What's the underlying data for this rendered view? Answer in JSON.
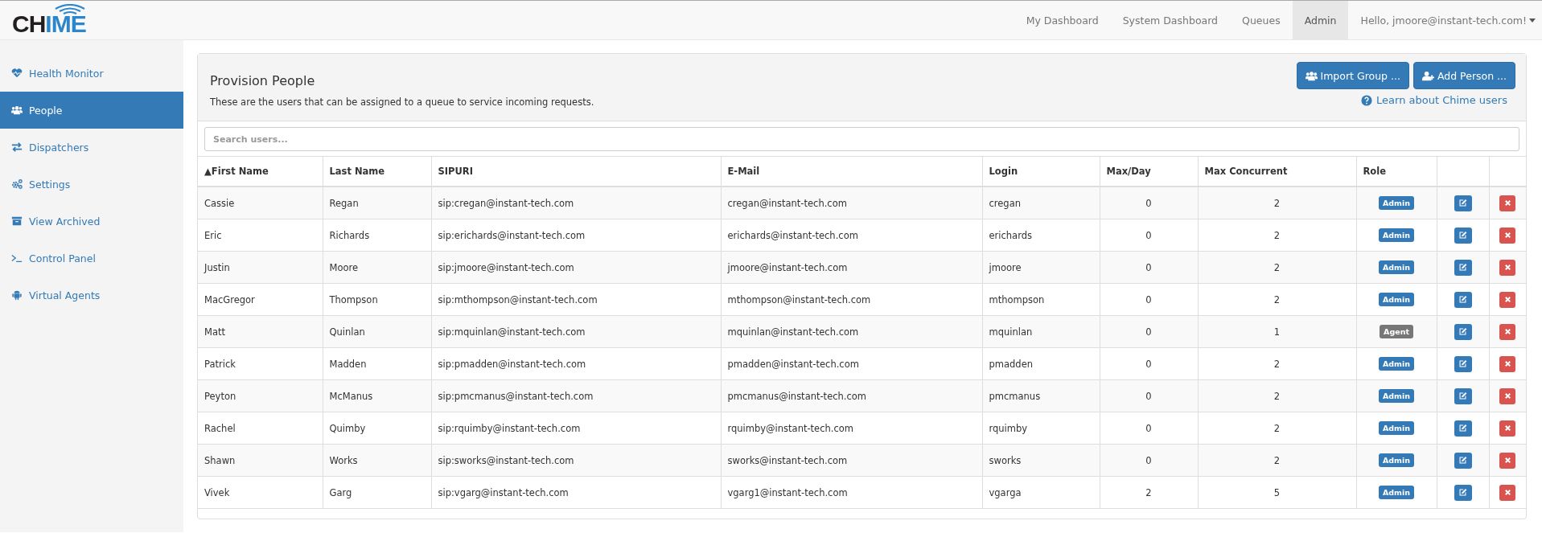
{
  "logo": {
    "dark": "CH",
    "accent": "IME"
  },
  "nav": [
    {
      "label": "My Dashboard",
      "selected": false
    },
    {
      "label": "System Dashboard",
      "selected": false
    },
    {
      "label": "Queues",
      "selected": false
    },
    {
      "label": "Admin",
      "selected": true
    }
  ],
  "user_menu": {
    "label": "Hello, jmoore@instant-tech.com!"
  },
  "sidebar": {
    "items": [
      {
        "label": "Health Monitor",
        "selected": false
      },
      {
        "label": "People",
        "selected": true
      },
      {
        "label": "Dispatchers",
        "selected": false
      },
      {
        "label": "Settings",
        "selected": false
      },
      {
        "label": "View Archived",
        "selected": false
      },
      {
        "label": "Control Panel",
        "selected": false
      },
      {
        "label": "Virtual Agents",
        "selected": false
      }
    ]
  },
  "panel": {
    "title": "Provision People",
    "description": "These are the users that can be assigned to a queue to service incoming requests.",
    "buttons": [
      "Import Group ...",
      "Add Person ..."
    ],
    "help_link": "Learn about Chime users",
    "search": {
      "placeholder": "Search users..."
    }
  },
  "table": {
    "columns": [
      "▲First Name",
      "Last Name",
      "SIPURI",
      "E-Mail",
      "Login",
      "Max/Day",
      "Max Concurrent",
      "Role"
    ],
    "rows": [
      {
        "first": "Cassie",
        "last": "Regan",
        "sipuri": "sip:cregan@instant-tech.com",
        "email": "cregan@instant-tech.com",
        "login": "cregan",
        "max_day": "0",
        "max_concurrent": "2",
        "role": {
          "label": "Admin",
          "kind": "admin"
        }
      },
      {
        "first": "Eric",
        "last": "Richards",
        "sipuri": "sip:erichards@instant-tech.com",
        "email": "erichards@instant-tech.com",
        "login": "erichards",
        "max_day": "0",
        "max_concurrent": "2",
        "role": {
          "label": "Admin",
          "kind": "admin"
        }
      },
      {
        "first": "Justin",
        "last": "Moore",
        "sipuri": "sip:jmoore@instant-tech.com",
        "email": "jmoore@instant-tech.com",
        "login": "jmoore",
        "max_day": "0",
        "max_concurrent": "2",
        "role": {
          "label": "Admin",
          "kind": "admin"
        }
      },
      {
        "first": "MacGregor",
        "last": "Thompson",
        "sipuri": "sip:mthompson@instant-tech.com",
        "email": "mthompson@instant-tech.com",
        "login": "mthompson",
        "max_day": "0",
        "max_concurrent": "2",
        "role": {
          "label": "Admin",
          "kind": "admin"
        }
      },
      {
        "first": "Matt",
        "last": "Quinlan",
        "sipuri": "sip:mquinlan@instant-tech.com",
        "email": "mquinlan@instant-tech.com",
        "login": "mquinlan",
        "max_day": "0",
        "max_concurrent": "1",
        "role": {
          "label": "Agent",
          "kind": "agent"
        }
      },
      {
        "first": "Patrick",
        "last": "Madden",
        "sipuri": "sip:pmadden@instant-tech.com",
        "email": "pmadden@instant-tech.com",
        "login": "pmadden",
        "max_day": "0",
        "max_concurrent": "2",
        "role": {
          "label": "Admin",
          "kind": "admin"
        }
      },
      {
        "first": "Peyton",
        "last": "McManus",
        "sipuri": "sip:pmcmanus@instant-tech.com",
        "email": "pmcmanus@instant-tech.com",
        "login": "pmcmanus",
        "max_day": "0",
        "max_concurrent": "2",
        "role": {
          "label": "Admin",
          "kind": "admin"
        }
      },
      {
        "first": "Rachel",
        "last": "Quimby",
        "sipuri": "sip:rquimby@instant-tech.com",
        "email": "rquimby@instant-tech.com",
        "login": "rquimby",
        "max_day": "0",
        "max_concurrent": "2",
        "role": {
          "label": "Admin",
          "kind": "admin"
        }
      },
      {
        "first": "Shawn",
        "last": "Works",
        "sipuri": "sip:sworks@instant-tech.com",
        "email": "sworks@instant-tech.com",
        "login": "sworks",
        "max_day": "0",
        "max_concurrent": "2",
        "role": {
          "label": "Admin",
          "kind": "admin"
        }
      },
      {
        "first": "Vivek",
        "last": "Garg",
        "sipuri": "sip:vgarg@instant-tech.com",
        "email": "vgarg1@instant-tech.com",
        "login": "vgarga",
        "max_day": "2",
        "max_concurrent": "5",
        "role": {
          "label": "Admin",
          "kind": "admin"
        }
      }
    ]
  }
}
